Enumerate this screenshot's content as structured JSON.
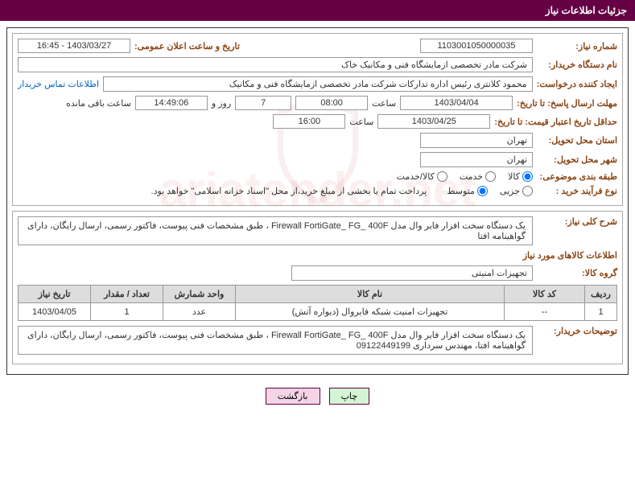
{
  "header": {
    "title": "جزئیات اطلاعات نیاز"
  },
  "section1": {
    "need_number_label": "شماره نیاز:",
    "need_number": "1103001050000035",
    "announce_date_label": "تاریخ و ساعت اعلان عمومی:",
    "announce_date": "1403/03/27 - 16:45",
    "buyer_org_label": "نام دستگاه خریدار:",
    "buyer_org": "شرکت مادر تخصصی ازمایشگاه فنی و مکانیک خاک",
    "requester_label": "ایجاد کننده درخواست:",
    "requester": "محمود کلانتری رئیس اداره تدارکات شرکت مادر تخصصی ازمایشگاه فنی و مکانیک",
    "contact_link": "اطلاعات تماس خریدار",
    "deadline_label": "مهلت ارسال پاسخ: تا تاریخ:",
    "deadline_date": "1403/04/04",
    "hour_label": "ساعت",
    "deadline_hour": "08:00",
    "days_remain": "7",
    "days_and_label": "روز و",
    "time_remain": "14:49:06",
    "time_remain_label": "ساعت باقی مانده",
    "validity_label": "حداقل تاریخ اعتبار قیمت: تا تاریخ:",
    "validity_date": "1403/04/25",
    "validity_hour": "16:00",
    "province_label": "استان محل تحویل:",
    "province": "تهران",
    "city_label": "شهر محل تحویل:",
    "city": "تهران",
    "category_label": "طبقه بندی موضوعی:",
    "cat_goods": "کالا",
    "cat_service": "خدمت",
    "cat_both": "کالا/خدمت",
    "process_label": "نوع فرآیند خرید :",
    "proc_partial": "جزیی",
    "proc_medium": "متوسط",
    "payment_note": "پرداخت تمام یا بخشی از مبلغ خرید،از محل \"اسناد خزانه اسلامی\" خواهد بود."
  },
  "section2": {
    "general_label": "شرح کلی نیاز:",
    "general_desc": "یک دستگاه سخت افزار فایر وال مدل Firewall FortiGate_ FG_ 400F ، طبق مشخصات فنی پیوست، فاکتور رسمی، ارسال رایگان، دارای گواهینامه افتا",
    "items_title": "اطلاعات کالاهای مورد نیاز",
    "group_label": "گروه کالا:",
    "group_value": "تجهیزات امنیتی",
    "table": {
      "headers": {
        "row": "ردیف",
        "code": "کد کالا",
        "name": "نام کالا",
        "unit": "واحد شمارش",
        "qty": "تعداد / مقدار",
        "date": "تاریخ نیاز"
      },
      "rows": [
        {
          "row": "1",
          "code": "--",
          "name": "تجهیزات امنیت شبکه فایروال (دیواره آتش)",
          "unit": "عدد",
          "qty": "1",
          "date": "1403/04/05"
        }
      ]
    },
    "buyer_notes_label": "توضیحات خریدار:",
    "buyer_notes": "یک دستگاه سخت افزار فایر وال مدل Firewall FortiGate_ FG_ 400F ، طبق مشخصات فنی پیوست، فاکتور رسمی، ارسال رایگان، دارای گواهینامه افتا، مهندس سرداری 09122449199"
  },
  "buttons": {
    "print": "چاپ",
    "back": "بازگشت"
  }
}
